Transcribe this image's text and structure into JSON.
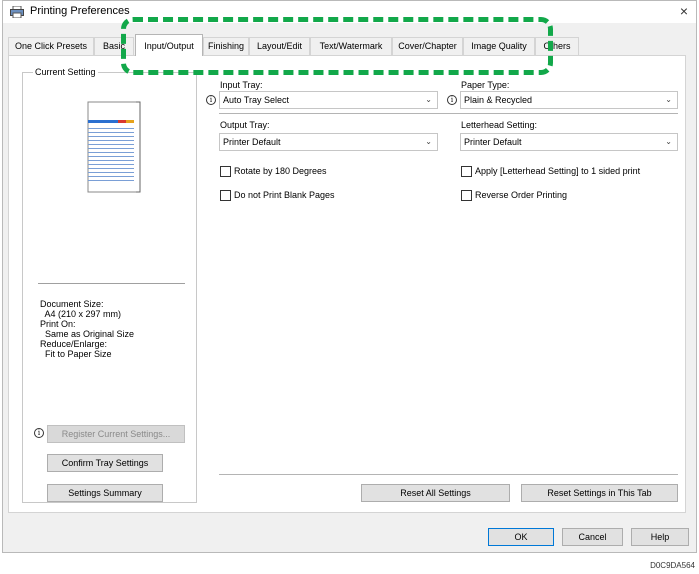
{
  "window": {
    "title": "Printing Preferences",
    "close_glyph": "×"
  },
  "tabs": [
    {
      "label": "One Click Presets"
    },
    {
      "label": "Basic"
    },
    {
      "label": "Input/Output",
      "active": true
    },
    {
      "label": "Finishing"
    },
    {
      "label": "Layout/Edit"
    },
    {
      "label": "Text/Watermark"
    },
    {
      "label": "Cover/Chapter"
    },
    {
      "label": "Image Quality"
    },
    {
      "label": "Others"
    }
  ],
  "current_setting": {
    "label": "Current Setting",
    "info": [
      {
        "text": "Document Size:"
      },
      {
        "text": "  A4 (210 x 297 mm)"
      },
      {
        "text": "Print On:"
      },
      {
        "text": "  Same as Original Size"
      },
      {
        "text": "Reduce/Enlarge:"
      },
      {
        "text": "  Fit to Paper Size"
      }
    ],
    "register_button": "Register Current Settings...",
    "confirm_tray_button": "Confirm Tray Settings",
    "summary_button": "Settings Summary"
  },
  "input_output": {
    "input_tray_label": "Input Tray:",
    "input_tray_value": "Auto Tray Select",
    "paper_type_label": "Paper Type:",
    "paper_type_value": "Plain & Recycled",
    "output_tray_label": "Output Tray:",
    "output_tray_value": "Printer Default",
    "letterhead_label": "Letterhead Setting:",
    "letterhead_value": "Printer Default",
    "rotate_label": "Rotate by 180 Degrees",
    "blank_pages_label": "Do not Print Blank Pages",
    "apply_letterhead_label": "Apply [Letterhead Setting] to 1 sided print",
    "reverse_order_label": "Reverse Order Printing",
    "reset_all_button": "Reset All Settings",
    "reset_tab_button": "Reset Settings in This Tab"
  },
  "footer": {
    "ok": "OK",
    "cancel": "Cancel",
    "help": "Help"
  },
  "figure_code": "D0C9DA564",
  "colors": {
    "highlight": "#12a84a",
    "focus_border": "#0078d7"
  }
}
